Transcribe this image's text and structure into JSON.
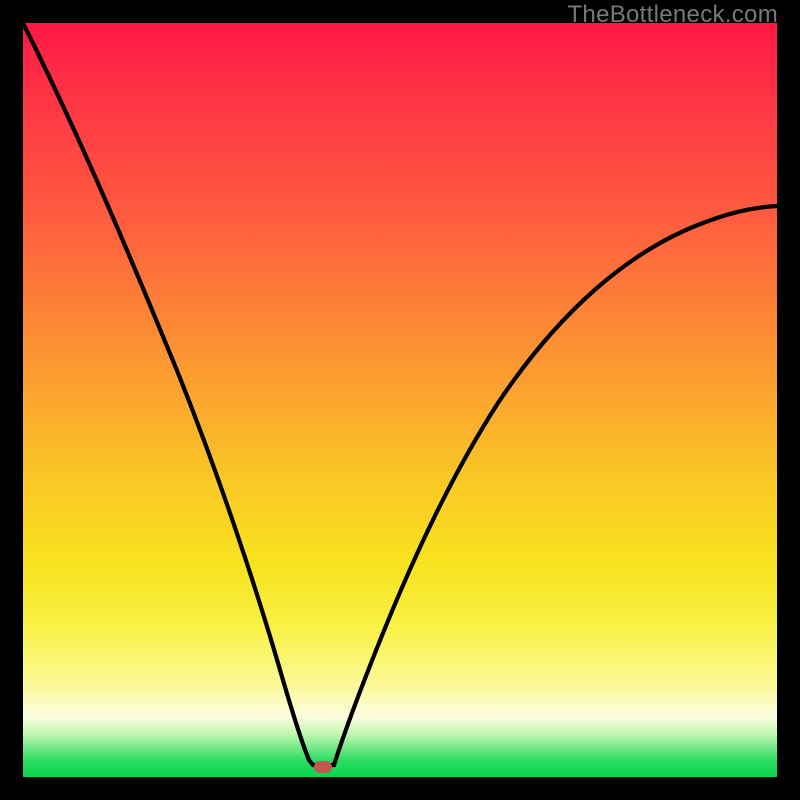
{
  "watermark": "TheBottleneck.com",
  "colors": {
    "frame": "#000000",
    "gradient_top": "#ff1846",
    "gradient_mid": "#fac626",
    "gradient_bottom": "#07d64d",
    "curve": "#000000",
    "marker": "#c05a4f"
  },
  "chart_data": {
    "type": "line",
    "title": "",
    "xlabel": "",
    "ylabel": "",
    "xlim": [
      0,
      100
    ],
    "ylim": [
      0,
      100
    ],
    "series": [
      {
        "name": "bottleneck-curve",
        "x": [
          0,
          5,
          10,
          15,
          20,
          25,
          30,
          33,
          35,
          37,
          38,
          40,
          42,
          45,
          50,
          55,
          60,
          65,
          70,
          75,
          80,
          85,
          90,
          95,
          100
        ],
        "y": [
          100,
          89,
          78,
          67,
          56,
          44,
          30,
          17,
          7,
          1,
          0,
          0,
          3,
          11,
          23,
          33,
          42,
          49,
          55,
          60,
          64,
          67,
          70,
          72,
          74
        ]
      }
    ],
    "marker": {
      "x": 39,
      "y": 0
    },
    "annotations": []
  }
}
